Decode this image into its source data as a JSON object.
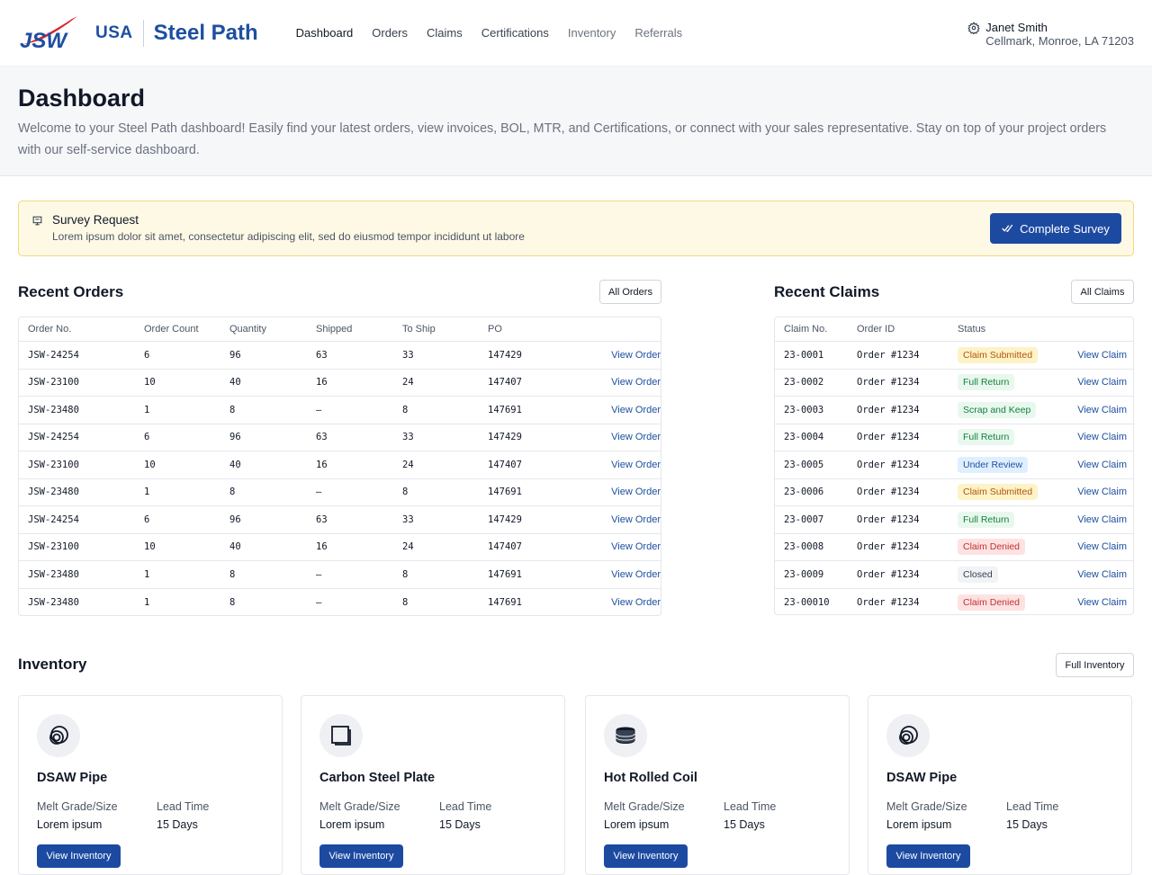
{
  "brand": {
    "logo_text": "JSW",
    "region": "USA",
    "product": "Steel Path",
    "color": "#1d4fa0"
  },
  "nav": [
    {
      "label": "Dashboard"
    },
    {
      "label": "Orders"
    },
    {
      "label": "Claims"
    },
    {
      "label": "Certifications"
    },
    {
      "label": "Inventory"
    },
    {
      "label": "Referrals"
    }
  ],
  "user": {
    "name": "Janet Smith",
    "address": "Cellmark, Monroe, LA 71203",
    "icon": "gear-icon"
  },
  "hero": {
    "title": "Dashboard",
    "description": "Welcome to your Steel Path dashboard! Easily find your latest orders, view invoices, BOL, MTR, and Certifications, or connect with your sales representative. Stay on top of your project orders with our self-service dashboard."
  },
  "survey": {
    "title": "Survey Request",
    "description": "Lorem ipsum dolor sit amet, consectetur adipiscing elit, sed do eiusmod tempor incididunt ut labore",
    "button": "Complete Survey"
  },
  "orders": {
    "title": "Recent Orders",
    "button": "All Orders",
    "columns": [
      "Order No.",
      "Order Count",
      "Quantity",
      "Shipped",
      "To Ship",
      "PO"
    ],
    "rows": [
      {
        "order_no": "JSW-24254",
        "count": "6",
        "quantity": "96",
        "shipped": "63",
        "to_ship": "33",
        "po": "147429",
        "action": "View Order"
      },
      {
        "order_no": "JSW-23100",
        "count": "10",
        "quantity": "40",
        "shipped": "16",
        "to_ship": "24",
        "po": "147407",
        "action": "View Order"
      },
      {
        "order_no": "JSW-23480",
        "count": "1",
        "quantity": "8",
        "shipped": "–",
        "to_ship": "8",
        "po": "147691",
        "action": "View Order"
      },
      {
        "order_no": "JSW-24254",
        "count": "6",
        "quantity": "96",
        "shipped": "63",
        "to_ship": "33",
        "po": "147429",
        "action": "View Order"
      },
      {
        "order_no": "JSW-23100",
        "count": "10",
        "quantity": "40",
        "shipped": "16",
        "to_ship": "24",
        "po": "147407",
        "action": "View Order"
      },
      {
        "order_no": "JSW-23480",
        "count": "1",
        "quantity": "8",
        "shipped": "–",
        "to_ship": "8",
        "po": "147691",
        "action": "View Order"
      },
      {
        "order_no": "JSW-24254",
        "count": "6",
        "quantity": "96",
        "shipped": "63",
        "to_ship": "33",
        "po": "147429",
        "action": "View Order"
      },
      {
        "order_no": "JSW-23100",
        "count": "10",
        "quantity": "40",
        "shipped": "16",
        "to_ship": "24",
        "po": "147407",
        "action": "View Order"
      },
      {
        "order_no": "JSW-23480",
        "count": "1",
        "quantity": "8",
        "shipped": "–",
        "to_ship": "8",
        "po": "147691",
        "action": "View Order"
      },
      {
        "order_no": "JSW-23480",
        "count": "1",
        "quantity": "8",
        "shipped": "–",
        "to_ship": "8",
        "po": "147691",
        "action": "View Order"
      }
    ]
  },
  "claims": {
    "title": "Recent Claims",
    "button": "All Claims",
    "columns": [
      "Claim No.",
      "Order ID",
      "Status"
    ],
    "rows": [
      {
        "claim_no": "23-0001",
        "order_id": "Order #1234",
        "status": "Claim Submitted",
        "tone": "yellow",
        "action": "View Claim"
      },
      {
        "claim_no": "23-0002",
        "order_id": "Order #1234",
        "status": "Full Return",
        "tone": "green",
        "action": "View Claim"
      },
      {
        "claim_no": "23-0003",
        "order_id": "Order #1234",
        "status": "Scrap and Keep",
        "tone": "green",
        "action": "View Claim"
      },
      {
        "claim_no": "23-0004",
        "order_id": "Order #1234",
        "status": "Full Return",
        "tone": "green",
        "action": "View Claim"
      },
      {
        "claim_no": "23-0005",
        "order_id": "Order #1234",
        "status": "Under Review",
        "tone": "blue",
        "action": "View Claim"
      },
      {
        "claim_no": "23-0006",
        "order_id": "Order #1234",
        "status": "Claim Submitted",
        "tone": "yellow",
        "action": "View Claim"
      },
      {
        "claim_no": "23-0007",
        "order_id": "Order #1234",
        "status": "Full Return",
        "tone": "green",
        "action": "View Claim"
      },
      {
        "claim_no": "23-0008",
        "order_id": "Order #1234",
        "status": "Claim Denied",
        "tone": "red",
        "action": "View Claim"
      },
      {
        "claim_no": "23-0009",
        "order_id": "Order #1234",
        "status": "Closed",
        "tone": "gray",
        "action": "View Claim"
      },
      {
        "claim_no": "23-00010",
        "order_id": "Order #1234",
        "status": "Claim Denied",
        "tone": "red",
        "action": "View Claim"
      }
    ]
  },
  "badge_colors": {
    "yellow": {
      "bg": "#fdf3c7",
      "fg": "#b45309"
    },
    "green": {
      "bg": "#e9f8ee",
      "fg": "#15803d"
    },
    "blue": {
      "bg": "#e0efff",
      "fg": "#1d4fa0"
    },
    "red": {
      "bg": "#fde2e2",
      "fg": "#c53030"
    },
    "gray": {
      "bg": "#f1f3f6",
      "fg": "#374151"
    }
  },
  "inventory": {
    "title": "Inventory",
    "button": "Full Inventory",
    "items": [
      {
        "name": "DSAW Pipe",
        "icon": "pipe-icon",
        "label1": "Melt Grade/Size",
        "value1": "Lorem ipsum",
        "label2": "Lead Time",
        "value2": "15 Days",
        "button": "View Inventory"
      },
      {
        "name": "Carbon Steel Plate",
        "icon": "plate-icon",
        "label1": "Melt Grade/Size",
        "value1": "Lorem ipsum",
        "label2": "Lead Time",
        "value2": "15 Days",
        "button": "View Inventory"
      },
      {
        "name": "Hot Rolled Coil",
        "icon": "coil-icon",
        "label1": "Melt Grade/Size",
        "value1": "Lorem ipsum",
        "label2": "Lead Time",
        "value2": "15 Days",
        "button": "View Inventory"
      },
      {
        "name": "DSAW Pipe",
        "icon": "pipe-icon",
        "label1": "Melt Grade/Size",
        "value1": "Lorem ipsum",
        "label2": "Lead Time",
        "value2": "15 Days",
        "button": "View Inventory"
      }
    ]
  }
}
